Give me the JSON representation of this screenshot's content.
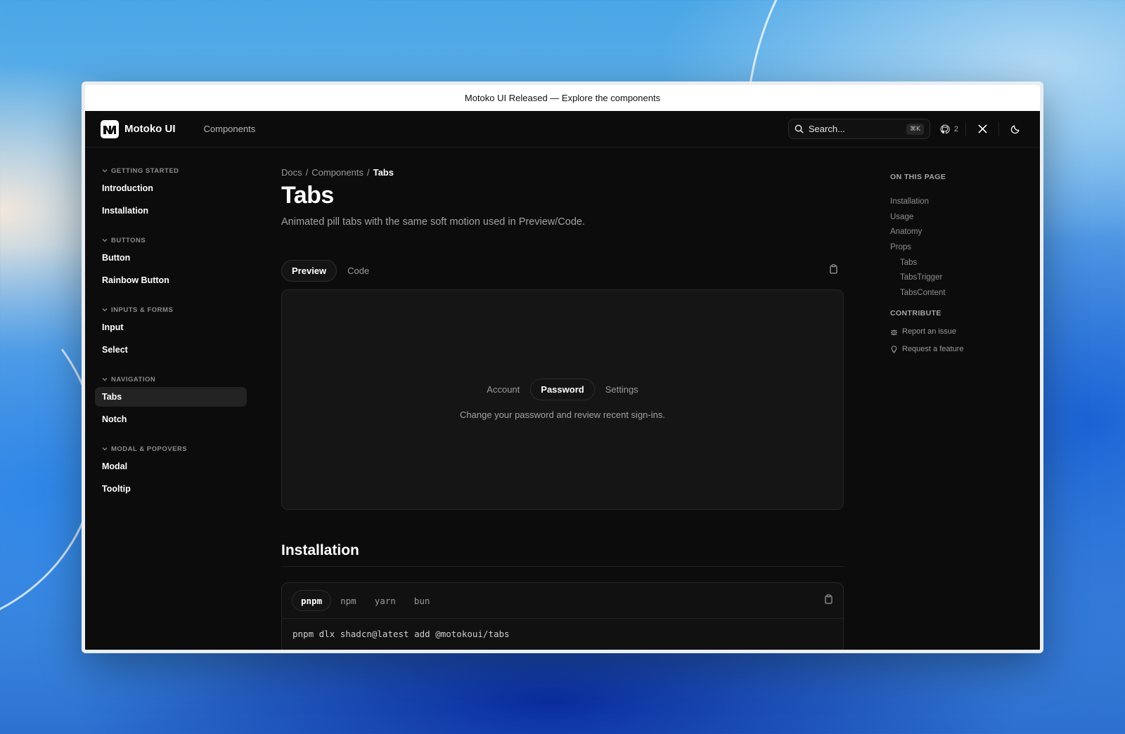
{
  "announcement": "Motoko UI Released — Explore the components",
  "header": {
    "brand": "Motoko UI",
    "nav_link": "Components",
    "search_placeholder": "Search...",
    "search_shortcut": "⌘K",
    "github_count": "2",
    "icons": [
      "search-icon",
      "github-icon",
      "x-icon",
      "moon-icon"
    ]
  },
  "sidebar": {
    "sections": [
      {
        "title": "GETTING STARTED",
        "items": [
          "Introduction",
          "Installation"
        ]
      },
      {
        "title": "BUTTONS",
        "items": [
          "Button",
          "Rainbow Button"
        ]
      },
      {
        "title": "INPUTS & FORMS",
        "items": [
          "Input",
          "Select"
        ]
      },
      {
        "title": "NAVIGATION",
        "items": [
          "Tabs",
          "Notch"
        ]
      },
      {
        "title": "MODAL & POPOVERS",
        "items": [
          "Modal",
          "Tooltip"
        ]
      }
    ],
    "active_item": "Tabs"
  },
  "main": {
    "breadcrumb": [
      "Docs",
      "Components",
      "Tabs"
    ],
    "title": "Tabs",
    "subtitle": "Animated pill tabs with the same soft motion used in Preview/Code.",
    "view_tabs": [
      "Preview",
      "Code"
    ],
    "active_view_tab": "Preview",
    "demo": {
      "tabs": [
        "Account",
        "Password",
        "Settings"
      ],
      "active_tab": "Password",
      "description": "Change your password and review recent sign-ins."
    },
    "installation_heading": "Installation",
    "package_managers": [
      "pnpm",
      "npm",
      "yarn",
      "bun"
    ],
    "active_package_manager": "pnpm",
    "install_command": "pnpm dlx shadcn@latest add @motokoui/tabs"
  },
  "toc": {
    "heading": "ON THIS PAGE",
    "items": [
      "Installation",
      "Usage",
      "Anatomy",
      "Props",
      "Tabs",
      "TabsTrigger",
      "TabsContent"
    ],
    "contribute_heading": "CONTRIBUTE",
    "contribute_items": [
      "Report an issue",
      "Request a feature"
    ]
  }
}
